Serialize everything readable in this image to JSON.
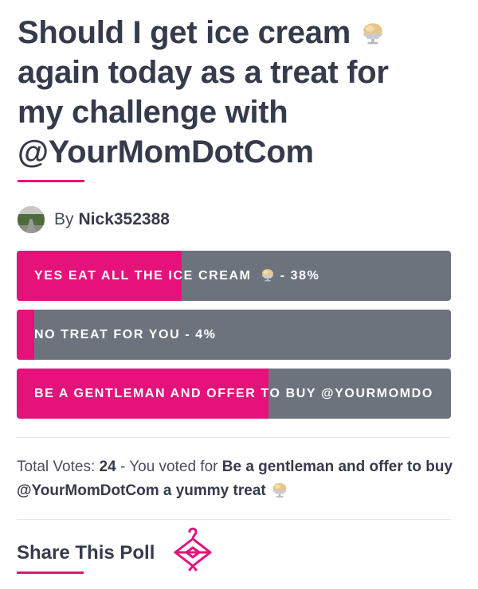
{
  "poll": {
    "title": "Should I get ice cream",
    "title_rest_1": "again today as a treat for",
    "title_rest_2": "my challenge with",
    "title_rest_3": "@YourMomDotCom",
    "author_prefix": "By",
    "author_name": "Nick352388",
    "options": [
      {
        "label": "YES EAT ALL THE ICE CREAM",
        "suffix": " - 38%",
        "percent": 38,
        "fill_fraction": 0.38
      },
      {
        "label": "NO TREAT FOR YOU - 4%",
        "percent": 4,
        "fill_fraction": 0.04
      },
      {
        "label": "BE A GENTLEMAN AND OFFER TO BUY @YOURMOMDO",
        "fill_fraction": 0.58
      }
    ],
    "total_votes_label": "Total Votes:",
    "total_votes": "24",
    "voted_for_prefix": "- You voted for",
    "voted_for_option": "Be a gentleman and offer to buy @YourMomDotCom a yummy treat"
  },
  "share": {
    "title": "Share This Poll",
    "icon": "hanger-bow-icon"
  },
  "colors": {
    "accent": "#e5127b",
    "bar_bg": "#6d737d",
    "text": "#363b4b"
  }
}
